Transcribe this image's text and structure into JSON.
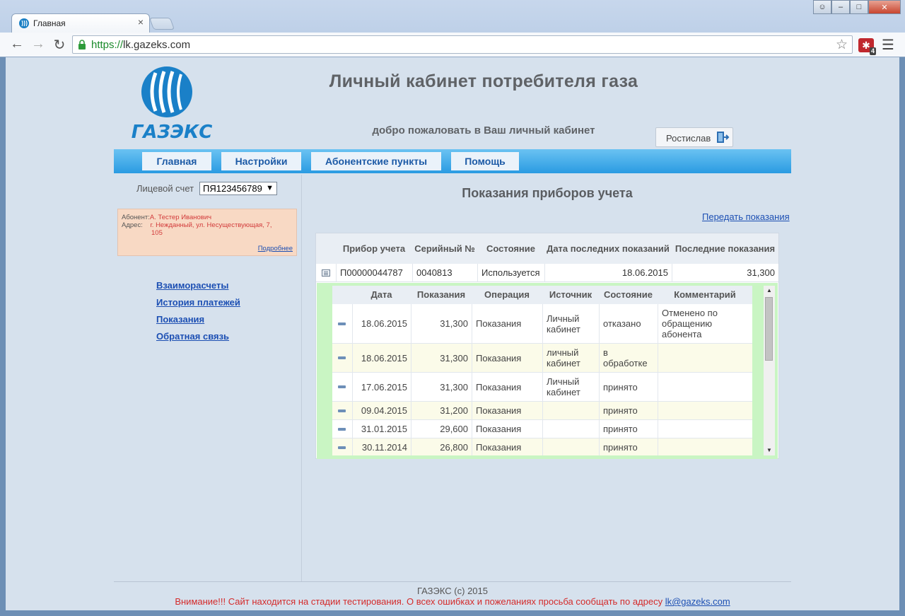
{
  "browser": {
    "tab_title": "Главная",
    "url_scheme": "https://",
    "url_host": "lk.gazeks.com",
    "extension_badge": "4"
  },
  "header": {
    "logo_text": "ГАЗЭКС",
    "title": "Личный кабинет потребителя газа",
    "welcome": "добро пожаловать в Ваш личный кабинет",
    "user_name": "Ростислав"
  },
  "menu": {
    "items": [
      "Главная",
      "Настройки",
      "Абонентские пункты",
      "Помощь"
    ]
  },
  "sidebar": {
    "account_label": "Лицевой счет",
    "account_value": "ПЯ123456789",
    "subscriber_label": "Абонент:",
    "subscriber_value": "А. Тестер Иванович",
    "address_label": "Адрес:",
    "address_value_1": "г. Нежданный, ул. Несуществующая, 7,",
    "address_value_2": "105",
    "more_link": "Подробнее",
    "nav": [
      "Взаиморасчеты",
      "История платежей",
      "Показания",
      "Обратная связь"
    ]
  },
  "main": {
    "title": "Показания приборов учета",
    "submit_link": "Передать показания",
    "columns": [
      "Прибор учета",
      "Серийный №",
      "Состояние",
      "Дата последних показаний",
      "Последние показания"
    ],
    "meter": {
      "id": "П00000044787",
      "serial": "0040813",
      "state": "Используется",
      "last_date": "18.06.2015",
      "last_value": "31,300"
    },
    "detail_columns": [
      "Дата",
      "Показания",
      "Операция",
      "Источник",
      "Состояние",
      "Комментарий"
    ],
    "detail_rows": [
      {
        "date": "18.06.2015",
        "value": "31,300",
        "operation": "Показания",
        "source": "Личный кабинет",
        "state": "отказано",
        "comment": "Отменено по обращению абонента"
      },
      {
        "date": "18.06.2015",
        "value": "31,300",
        "operation": "Показания",
        "source": "личный кабинет",
        "state": "в обработке",
        "comment": ""
      },
      {
        "date": "17.06.2015",
        "value": "31,300",
        "operation": "Показания",
        "source": "Личный кабинет",
        "state": "принято",
        "comment": ""
      },
      {
        "date": "09.04.2015",
        "value": "31,200",
        "operation": "Показания",
        "source": "",
        "state": "принято",
        "comment": ""
      },
      {
        "date": "31.01.2015",
        "value": "29,600",
        "operation": "Показания",
        "source": "",
        "state": "принято",
        "comment": ""
      },
      {
        "date": "30.11.2014",
        "value": "26,800",
        "operation": "Показания",
        "source": "",
        "state": "принято",
        "comment": ""
      }
    ]
  },
  "footer": {
    "copyright": "ГАЗЭКС (c) 2015",
    "warning": "Внимание!!! Сайт находится на стадии тестирования. О всех ошибках и пожеланиях просьба сообщать по адресу",
    "email": "lk@gazeks.com"
  },
  "colors": {
    "menubar": "#2a9be2",
    "link": "#1c4fb3",
    "warning": "#d42a2a",
    "detail_bg": "#c9f5c3",
    "info_bg": "#f8d9c4"
  }
}
